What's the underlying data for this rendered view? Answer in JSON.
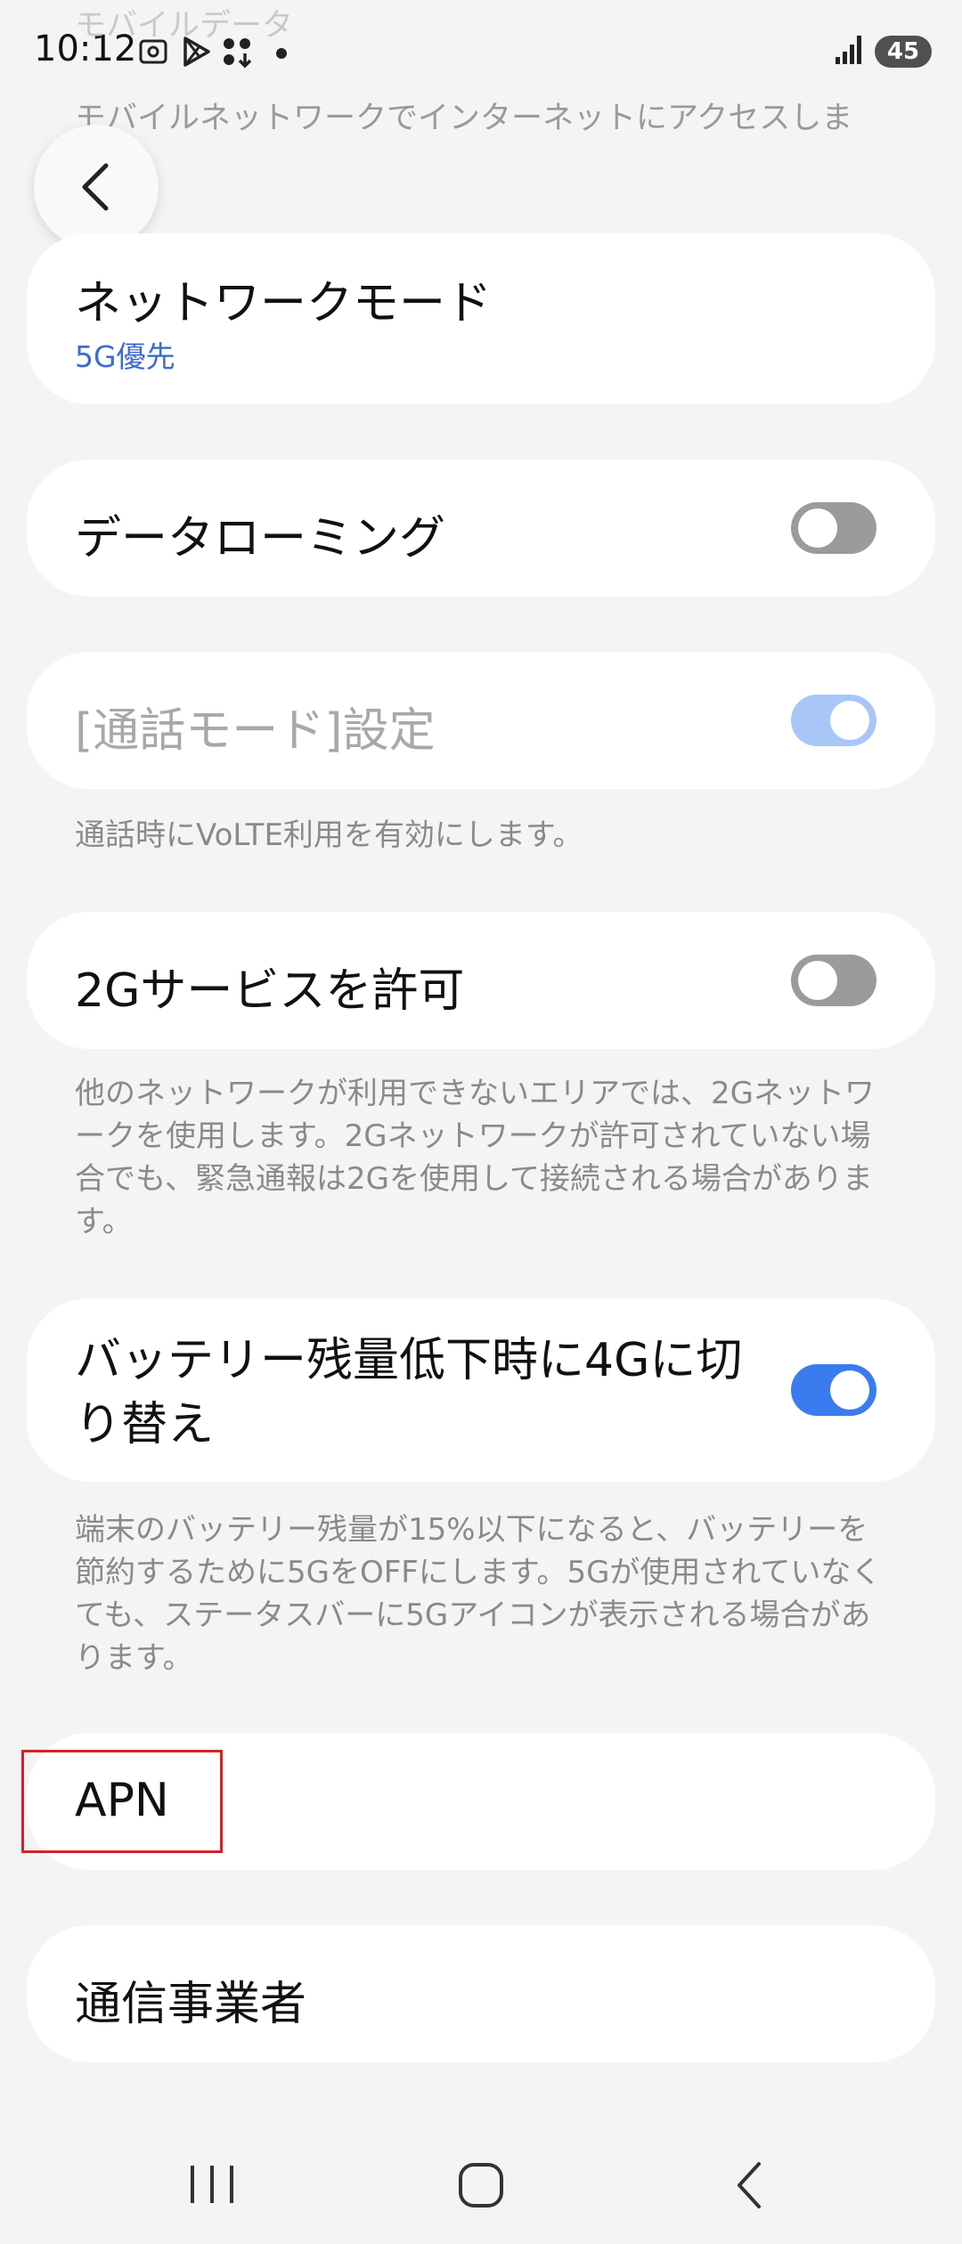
{
  "status_bar": {
    "time": "10:12",
    "battery": "45",
    "icons": [
      "screenshot-icon",
      "play-store-icon",
      "app-download-icon",
      "notification-dot-icon",
      "signal-icon"
    ]
  },
  "header": {
    "top_cut_text": "モバイルデータ",
    "subtitle_cut": "モバイルネットワークでインターネットにアクセスしま"
  },
  "settings": {
    "network_mode": {
      "label": "ネットワークモード",
      "value": "5G優先"
    },
    "data_roaming": {
      "label": "データローミング",
      "state": "off"
    },
    "call_mode": {
      "label": "[通話モード]設定",
      "state": "on-disabled",
      "description": "通話時にVoLTE利用を有効にします。"
    },
    "allow_2g": {
      "label": "2Gサービスを許可",
      "state": "off",
      "description": "他のネットワークが利用できないエリアでは、2Gネットワークを使用します。2Gネットワークが許可されていない場合でも、緊急通報は2Gを使用して接続される場合があります。"
    },
    "battery_4g": {
      "label": "バッテリー残量低下時に4Gに切り替え",
      "state": "on",
      "description": "端末のバッテリー残量が15%以下になると、バッテリーを節約するために5GをOFFにします。5Gが使用されていなくても、ステータスバーに5Gアイコンが表示される場合があります。"
    },
    "apn": {
      "label": "APN"
    },
    "carrier": {
      "label": "通信事業者"
    }
  },
  "colors": {
    "accent": "#3a7bef",
    "toggle_off": "#9b9b9b",
    "toggle_disabled": "#a9c6f8",
    "highlight_box": "#d2232a",
    "background": "#f4f4f4"
  }
}
